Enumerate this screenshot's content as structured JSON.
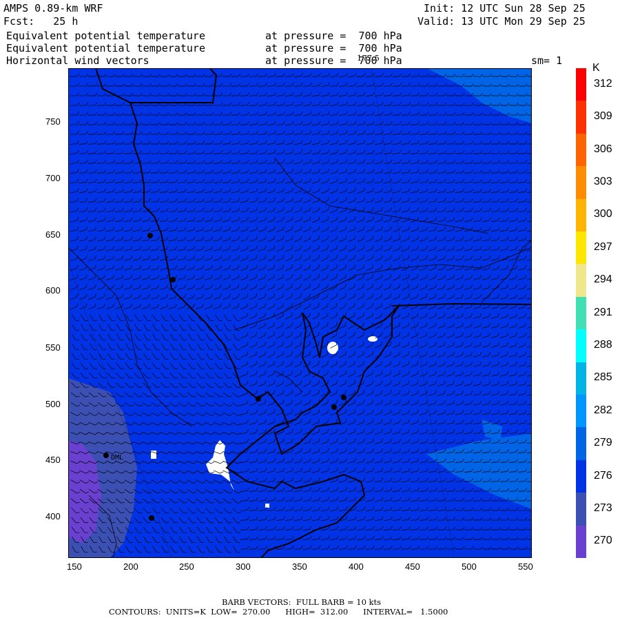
{
  "header": {
    "model": "AMPS 0.89-km WRF",
    "forecast": "Fcst:   25 h",
    "init": "Init: 12 UTC Sun 28 Sep 25",
    "valid": "Valid: 13 UTC Mon 29 Sep 25",
    "line1_field": "Equivalent potential temperature",
    "line1_level": "at pressure =  700 hPa",
    "line2_field": "Equivalent potential temperature",
    "line2_level": "at pressure =  700 hPa",
    "line3_field": "Horizontal wind vectors",
    "line3_level": "at pressure =  700 hPa",
    "overlap_mark": "177.5",
    "smoothing": "sm= 1"
  },
  "axes": {
    "x_ticks": [
      "150",
      "200",
      "250",
      "300",
      "350",
      "400",
      "450",
      "500",
      "550"
    ],
    "y_ticks": [
      "750",
      "700",
      "650",
      "600",
      "550",
      "500",
      "450",
      "400"
    ]
  },
  "colorbar": {
    "unit": "K",
    "labels": [
      "312",
      "309",
      "306",
      "303",
      "300",
      "297",
      "294",
      "291",
      "288",
      "285",
      "282",
      "279",
      "276",
      "273",
      "270"
    ],
    "colors": [
      "#ff0000",
      "#ff3000",
      "#ff6400",
      "#ff8c00",
      "#ffb400",
      "#ffe600",
      "#f0e68c",
      "#40e0b4",
      "#00ffff",
      "#00b4e6",
      "#0096ff",
      "#0064e6",
      "#0032e6",
      "#3c50b4",
      "#6a40d0"
    ]
  },
  "map": {
    "background_color": "#0032e6",
    "barb_color": "#000000",
    "station_label": "DML"
  },
  "footer": {
    "barb_line": "BARB VECTORS:  FULL BARB = 10 kts",
    "contour_line": "CONTOURS:  UNITS=K  LOW=  270.00      HIGH=  312.00      INTERVAL=   1.5000"
  }
}
